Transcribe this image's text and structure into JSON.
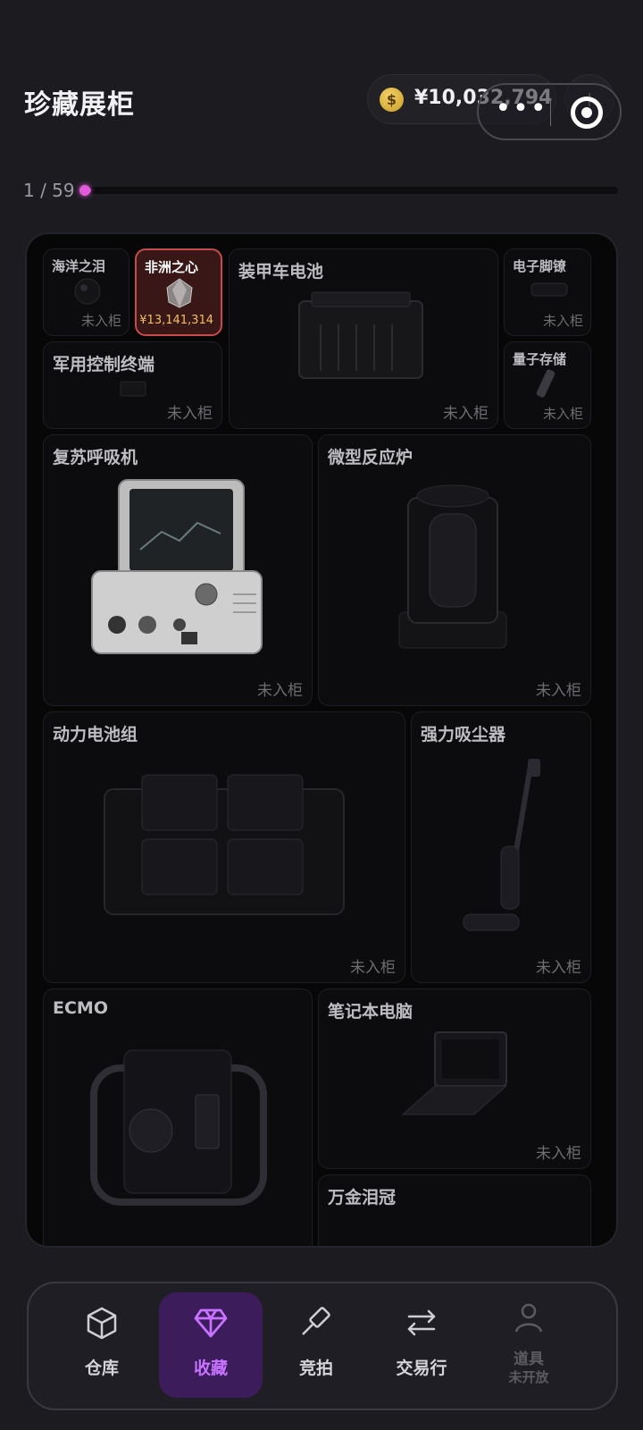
{
  "header": {
    "title": "珍藏展柜",
    "balance": "¥10,032,794",
    "coin_symbol": "$",
    "add_symbol": "+"
  },
  "capsule": {
    "more": "•••"
  },
  "progress": {
    "label": "1 / 59",
    "current": 1,
    "total": 59
  },
  "items": [
    {
      "name": "海洋之泪",
      "status": "未入柜"
    },
    {
      "name": "非洲之心",
      "price": "¥13,141,314",
      "highlighted": true
    },
    {
      "name": "装甲车电池",
      "status": "未入柜"
    },
    {
      "name": "电子脚镣",
      "status": "未入柜"
    },
    {
      "name": "军用控制终端",
      "status": "未入柜"
    },
    {
      "name": "量子存储",
      "status": "未入柜"
    },
    {
      "name": "复苏呼吸机",
      "status": "未入柜"
    },
    {
      "name": "微型反应炉",
      "status": "未入柜"
    },
    {
      "name": "动力电池组",
      "status": "未入柜"
    },
    {
      "name": "强力吸尘器",
      "status": "未入柜"
    },
    {
      "name": "ECMO",
      "status": ""
    },
    {
      "name": "笔记本电脑",
      "status": "未入柜"
    },
    {
      "name": "万金泪冠",
      "status": ""
    }
  ],
  "tabs": [
    {
      "label": "仓库",
      "icon": "box-icon"
    },
    {
      "label": "收藏",
      "icon": "diamond-icon",
      "active": true
    },
    {
      "label": "竞拍",
      "icon": "gavel-icon"
    },
    {
      "label": "交易行",
      "icon": "exchange-icon"
    },
    {
      "label": "道具",
      "sub": "未开放",
      "icon": "person-icon",
      "disabled": true
    }
  ],
  "colors": {
    "accent": "#c873ff",
    "progress": "#e35ad9",
    "highlight_border": "#c84a4a",
    "price": "#f0c060"
  }
}
